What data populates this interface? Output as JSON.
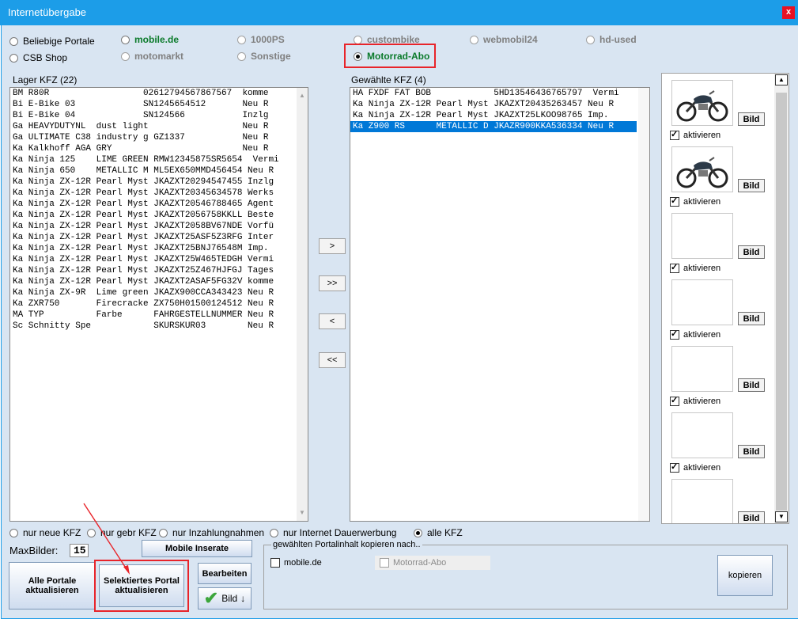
{
  "window": {
    "title": "Internetübergabe",
    "close_label": "x"
  },
  "portals": {
    "beliebige": "Beliebige Portale",
    "csb": "CSB Shop",
    "mobile": "mobile.de",
    "motomarkt": "motomarkt",
    "ps1000": "1000PS",
    "sonstige": "Sonstige",
    "custombike": "custombike",
    "motorrad_abo": "Motorrad-Abo",
    "webmobil": "webmobil24",
    "hdused": "hd-used"
  },
  "lager": {
    "label": "Lager KFZ (22)",
    "rows": [
      "BM R80R                  0261279456786756​7  komme",
      "Bi E-Bike 03             SN1245654512       Neu R",
      "Bi E-Bike 04             SN124566           Inzlg",
      "Ga HEAVYDUTYNL  dust light                  Neu R",
      "Ga ULTIMATE C38 industry g GZ1337           Neu R",
      "Ka Kalkhoff AGA GRY                         Neu R",
      "Ka Ninja 125    LIME GREEN RMW12345875SR5654  Vermi",
      "Ka Ninja 650    METALLIC M ML5EX650MMD456454 Neu R",
      "Ka Ninja ZX-12R Pearl Myst JKAZXT20294547455 Inzlg",
      "Ka Ninja ZX-12R Pearl Myst JKAZXT20345634578 Werks",
      "Ka Ninja ZX-12R Pearl Myst JKAZXT20546788465 Agent",
      "Ka Ninja ZX-12R Pearl Myst JKAZXT2056758KKLL Beste",
      "Ka Ninja ZX-12R Pearl Myst JKAZXT2058BV67NDE Vorfü",
      "Ka Ninja ZX-12R Pearl Myst JKAZXT25ASF5Z3RFG Inter",
      "Ka Ninja ZX-12R Pearl Myst JKAZXT25BNJ76548M Imp.",
      "Ka Ninja ZX-12R Pearl Myst JKAZXT25W465TEDGH Vermi",
      "Ka Ninja ZX-12R Pearl Myst JKAZXT25Z467HJFGJ Tages",
      "Ka Ninja ZX-12R Pearl Myst JKAZXT2ASAF5FG32V komme",
      "Ka Ninja ZX-9R  Lime green JKAZX900CCA343423 Neu R",
      "Ka ZXR750       Firecracke ZX750H01500124512 Neu R",
      "MA TYP          Farbe      FAHRGESTELLNUMMER Neu R",
      "Sc Schnitty Spe            SKURSKUR03        Neu R"
    ]
  },
  "gewaehlt": {
    "label": "Gewählte KFZ (4)",
    "rows": [
      "HA FXDF FAT BOB            5HD13546436765797  Vermi",
      "Ka Ninja ZX-12R Pearl Myst JKAZXT20435263457 Neu R",
      "Ka Ninja ZX-12R Pearl Myst JKAZXT25LKOO98765 Imp.",
      "Ka Z900 RS      METALLIC D JKAZR900KKA536334 Neu R"
    ],
    "selected_index": 3
  },
  "move_buttons": {
    "add": ">",
    "add_all": ">>",
    "remove": "<",
    "remove_all": "<<"
  },
  "images": {
    "bild_label": "Bild",
    "aktivieren_label": "aktivieren"
  },
  "filters": {
    "neue": "nur neue KFZ",
    "gebr": "nur gebr KFZ",
    "inzahlung": "nur Inzahlungnahmen",
    "dauerwerbung": "nur Internet Dauerwerbung",
    "alle": "alle KFZ"
  },
  "maxbilder": {
    "label": "MaxBilder:",
    "value": "15"
  },
  "buttons": {
    "mobile_inserate": "Mobile Inserate",
    "alle_portale_l1": "Alle Portale",
    "alle_portale_l2": "aktualisieren",
    "selektiert_l1": "Selektiertes Portal",
    "selektiert_l2": "aktualisieren",
    "bearbeiten": "Bearbeiten",
    "bild_down": "Bild",
    "kopieren": "kopieren"
  },
  "copy_group": {
    "legend": "gewählten Portalinhalt kopieren nach..",
    "mobile": "mobile.de",
    "motorrad_abo": "Motorrad-Abo"
  },
  "colors": {
    "titlebar": "#1c9de8",
    "selection": "#0078d7",
    "highlight": "#e8242a",
    "green": "#0a7a2a"
  }
}
